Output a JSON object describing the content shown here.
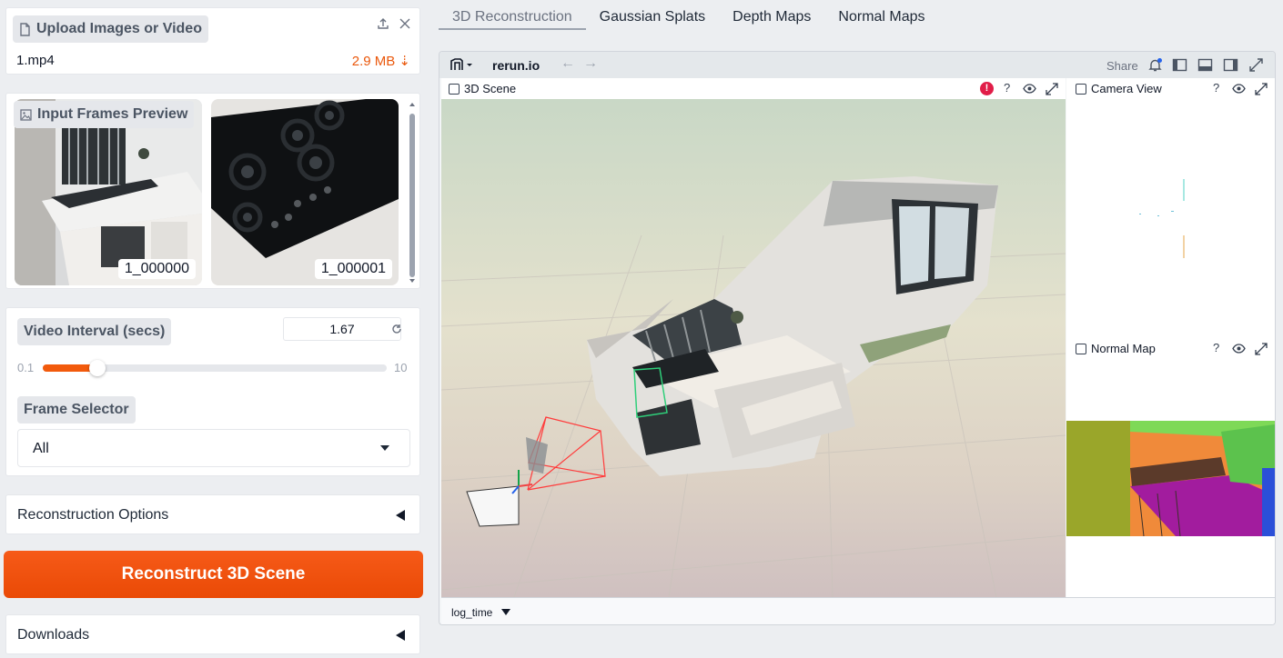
{
  "upload": {
    "label": "Upload Images or Video",
    "file_name": "1.mp4",
    "file_size": "2.9 MB ⇣"
  },
  "preview": {
    "label": "Input Frames Preview",
    "frames": [
      {
        "caption": "1_000000"
      },
      {
        "caption": "1_000001"
      }
    ]
  },
  "settings": {
    "interval_label": "Video Interval (secs)",
    "interval_value": "1.67",
    "slider_min": "0.1",
    "slider_max": "10",
    "slider_value": 1.67,
    "frame_selector_label": "Frame Selector",
    "frame_selector_value": "All"
  },
  "accordions": {
    "reconstruction_options": "Reconstruction Options",
    "downloads": "Downloads"
  },
  "reconstruct_button": "Reconstruct 3D Scene",
  "tabs": [
    {
      "label": "3D Reconstruction",
      "active": true
    },
    {
      "label": "Gaussian Splats",
      "active": false
    },
    {
      "label": "Depth Maps",
      "active": false
    },
    {
      "label": "Normal Maps",
      "active": false
    }
  ],
  "viewer": {
    "app_title": "rerun.io",
    "share": "Share",
    "scene_tab": "3D Scene",
    "camera_tab": "Camera View",
    "normal_tab": "Normal Map",
    "warn_badge": "!",
    "help_glyph": "?",
    "timeline": "log_time"
  },
  "colors": {
    "accent": "#f25a0c",
    "button": "#ee4f0a",
    "file_size": "#ea580c",
    "warning": "#e11d48"
  },
  "icons": {
    "file": "file-icon",
    "upload": "upload-icon",
    "close": "close-icon",
    "image": "image-icon",
    "reset": "reset-icon",
    "bell": "bell-icon",
    "eye": "eye-icon",
    "expand": "expand-icon"
  }
}
